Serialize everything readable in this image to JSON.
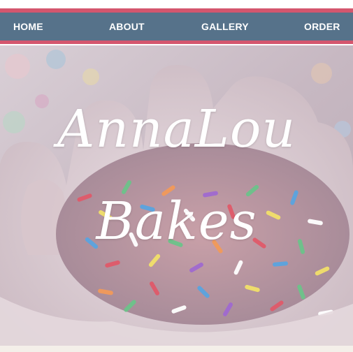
{
  "nav": {
    "items": [
      {
        "label": "HOME"
      },
      {
        "label": "ABOUT"
      },
      {
        "label": "GALLERY"
      },
      {
        "label": "ORDER"
      }
    ]
  },
  "hero": {
    "title_line1": "AnnaLou",
    "title_line2": "Bakes"
  },
  "colors": {
    "nav_bar": "#56728a",
    "nav_accent": "#d4566e",
    "title_text": "#ffffff"
  }
}
